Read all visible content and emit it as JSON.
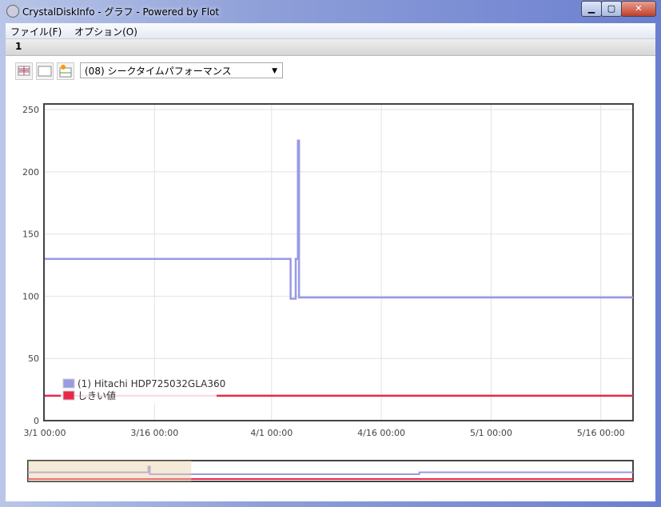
{
  "window": {
    "title": "CrystalDiskInfo - グラフ - Powered by Flot",
    "minimize": "▁",
    "maximize": "▢",
    "close": "✕"
  },
  "menu": [
    {
      "label": "ファイル(F)"
    },
    {
      "label": "オプション(O)"
    }
  ],
  "tab": "1",
  "toolbar": {
    "selected_attribute": "(08) シークタイムパフォーマンス"
  },
  "colors": {
    "series": "#9999e6",
    "threshold": "#e8274b"
  },
  "chart_data": {
    "type": "line",
    "ylim": [
      0,
      250
    ],
    "yticks": [
      "0",
      "50",
      "100",
      "150",
      "200",
      "250"
    ],
    "x_unit": "days since 3/1 00:00",
    "xlim": [
      0,
      80.4
    ],
    "xticks": [
      {
        "day": 0,
        "label": "3/1 00:00"
      },
      {
        "day": 15,
        "label": "3/16 00:00"
      },
      {
        "day": 31,
        "label": "4/1 00:00"
      },
      {
        "day": 46,
        "label": "4/16 00:00"
      },
      {
        "day": 61,
        "label": "5/1 00:00"
      },
      {
        "day": 76,
        "label": "5/16 00:00"
      }
    ],
    "series": [
      {
        "name": "(1) Hitachi HDP725032GLA360",
        "color": "#9999e6",
        "points": [
          [
            0,
            130
          ],
          [
            33.6,
            130
          ],
          [
            33.6,
            98
          ],
          [
            34.3,
            98
          ],
          [
            34.3,
            130
          ],
          [
            34.6,
            130
          ],
          [
            34.6,
            225
          ],
          [
            34.75,
            225
          ],
          [
            34.75,
            99
          ],
          [
            80.4,
            99
          ]
        ]
      },
      {
        "name": "しきい値",
        "color": "#e8274b",
        "points": [
          [
            0,
            20
          ],
          [
            80.4,
            20
          ]
        ]
      }
    ],
    "legend": "bottom-left",
    "overview_selection": [
      0,
      0.27
    ]
  }
}
